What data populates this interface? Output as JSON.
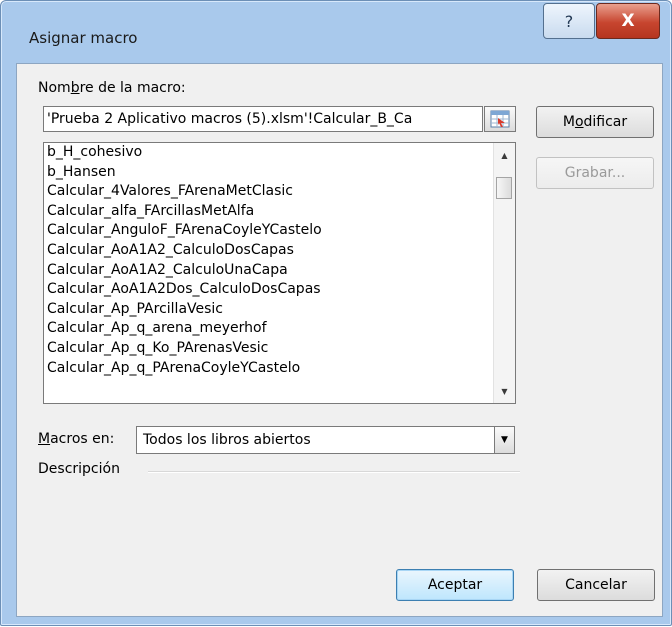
{
  "window": {
    "title": "Asignar macro",
    "help_label": "?",
    "close_label": "X"
  },
  "macro_name": {
    "label_pre": "Nom",
    "label_key": "b",
    "label_post": "re de la macro:",
    "value": "'Prueba 2 Aplicativo macros (5).xlsm'!Calcular_B_Ca"
  },
  "macro_list": {
    "items": [
      "b_H_cohesivo",
      "b_Hansen",
      "Calcular_4Valores_FArenaMetClasic",
      "Calcular_alfa_FArcillasMetAlfa",
      "Calcular_AnguloF_FArenaCoyleYCastelo",
      "Calcular_AoA1A2_CalculoDosCapas",
      "Calcular_AoA1A2_CalculoUnaCapa",
      "Calcular_AoA1A2Dos_CalculoDosCapas",
      "Calcular_Ap_PArcillaVesic",
      "Calcular_Ap_q_arena_meyerhof",
      "Calcular_Ap_q_Ko_PArenasVesic",
      "Calcular_Ap_q_PArenaCoyleYCastelo"
    ],
    "scroll_position": 0.05
  },
  "buttons": {
    "modify_pre": "M",
    "modify_key": "o",
    "modify_post": "dificar",
    "record": "Grabar...",
    "accept": "Aceptar",
    "cancel": "Cancelar"
  },
  "macros_in": {
    "label_key": "M",
    "label_post": "acros en:",
    "selected": "Todos los libros abiertos"
  },
  "description": {
    "label": "Descripción"
  },
  "colors": {
    "frame": "#a9c9ec",
    "close_button": "#c7452f",
    "default_button": "#bee6fd"
  }
}
